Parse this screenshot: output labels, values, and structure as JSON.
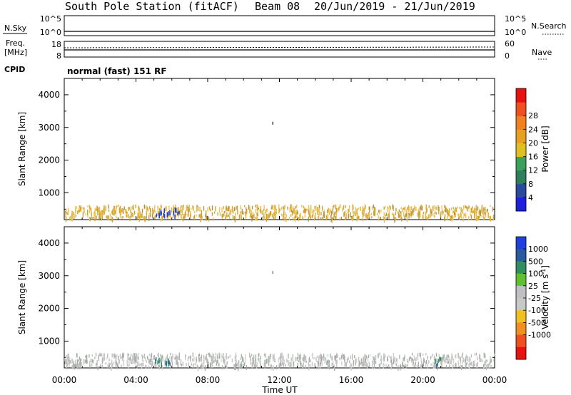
{
  "title": {
    "station": "South Pole Station (fitACF)",
    "beam": "Beam 08",
    "date_range": "20/Jun/2019 - 21/Jun/2019"
  },
  "top_panels": {
    "nsky_label": "N.Sky",
    "nsky_tick_hi": "10^5",
    "nsky_tick_lo": "10^0",
    "nsearch_label": "N.Search",
    "nsearch_tick_hi": "10^5",
    "nsearch_tick_lo": "10^0",
    "freq_label_1": "Freq.",
    "freq_label_2": "[MHz]",
    "freq_tick_hi": "18",
    "freq_tick_lo": "8",
    "nave_label": "Nave",
    "nave_tick_hi": "60",
    "nave_tick_lo": "0",
    "cpid_label": "CPID",
    "cpid_value": "normal (fast) 151 RF"
  },
  "chart_data": [
    {
      "type": "heatmap",
      "panel": "power",
      "xlabel": "",
      "ylabel": "Slant Range [km]",
      "x_ticks": [
        "00:00",
        "04:00",
        "08:00",
        "12:00",
        "16:00",
        "20:00",
        "00:00"
      ],
      "y_ticks": [
        "1000",
        "2000",
        "3000",
        "4000"
      ],
      "ylim": [
        180,
        4500
      ],
      "xlim_hours": [
        0,
        24
      ],
      "colorbar": {
        "label": "Power [dB]",
        "ticks": [
          "4",
          "8",
          "12",
          "16",
          "20",
          "24",
          "28"
        ],
        "colors": [
          "#1f1fe0",
          "#2a4aa0",
          "#2f7f5f",
          "#3aa05a",
          "#e0c020",
          "#e8a020",
          "#f08020",
          "#f05020",
          "#e81010"
        ]
      },
      "scatter_band_km": [
        250,
        650
      ],
      "isolated_echo": {
        "hour": 11.6,
        "range_km": 3130
      },
      "strong_echo_hours": [
        5.2,
        5.7,
        6.2
      ]
    },
    {
      "type": "heatmap",
      "panel": "velocity",
      "xlabel": "Time UT",
      "ylabel": "Slant Range [km]",
      "x_ticks": [
        "00:00",
        "04:00",
        "08:00",
        "12:00",
        "16:00",
        "20:00",
        "00:00"
      ],
      "y_ticks": [
        "1000",
        "2000",
        "3000",
        "4000"
      ],
      "ylim": [
        180,
        4500
      ],
      "xlim_hours": [
        0,
        24
      ],
      "colorbar": {
        "label": "Velocity [m s^-1]",
        "ticks": [
          "1000",
          "500",
          "100",
          "25",
          "-25",
          "-100",
          "-500",
          "-1000"
        ],
        "colors": [
          "#1f3fe0",
          "#2a5aa0",
          "#2f8f5f",
          "#60c030",
          "#c0c0c0",
          "#c8c8c8",
          "#f0c020",
          "#f09020",
          "#f05020",
          "#e81010"
        ]
      },
      "scatter_band_km": [
        250,
        650
      ],
      "isolated_echo": {
        "hour": 11.6,
        "range_km": 3100
      },
      "strong_echo_hours": [
        5.2,
        5.7,
        20.8
      ]
    }
  ]
}
